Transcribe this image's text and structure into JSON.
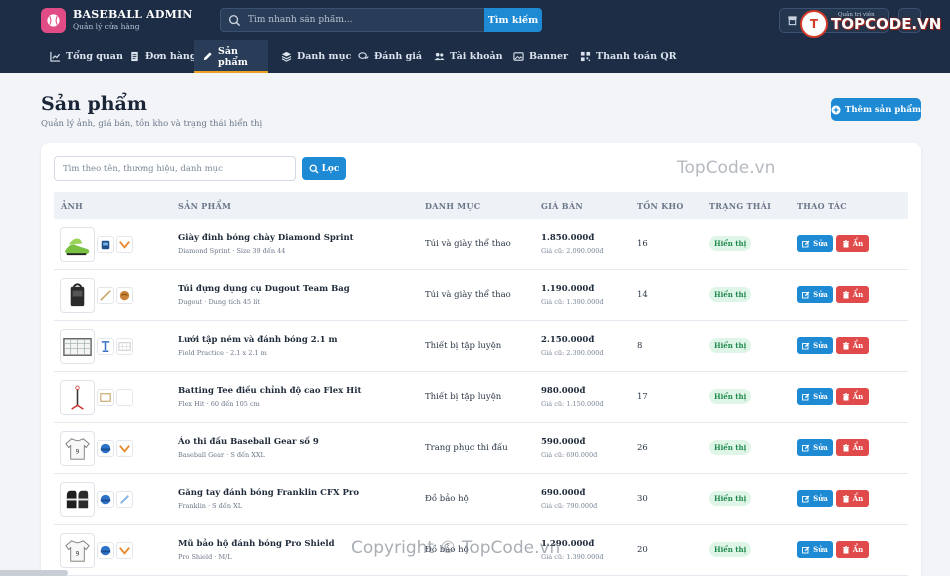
{
  "brand": {
    "name": "BASEBALL ADMIN",
    "subtitle": "Quản lý cửa hàng"
  },
  "search": {
    "placeholder": "Tìm nhanh sản phẩm...",
    "button": "Tìm kiếm"
  },
  "header_right": {
    "shop_small_label": "Quản trị viên"
  },
  "nav": [
    {
      "label": "Tổng quan",
      "icon": "chart-line-icon"
    },
    {
      "label": "Đơn hàng",
      "icon": "receipt-icon"
    },
    {
      "label": "Sản phẩm",
      "icon": "pen-icon",
      "active": true
    },
    {
      "label": "Danh mục",
      "icon": "layers-icon"
    },
    {
      "label": "Đánh giá",
      "icon": "comments-icon"
    },
    {
      "label": "Tài khoản",
      "icon": "users-icon"
    },
    {
      "label": "Banner",
      "icon": "image-icon"
    },
    {
      "label": "Thanh toán QR",
      "icon": "qr-icon"
    }
  ],
  "page": {
    "title": "Sản phẩm",
    "subtitle": "Quản lý ảnh, giá bán, tồn kho và trạng thái hiển thị",
    "add_button": "Thêm sản phẩm"
  },
  "filter": {
    "placeholder": "Tìm theo tên, thương hiệu, danh mục",
    "button": "Lọc"
  },
  "table": {
    "headers": [
      "ẢNH",
      "SẢN PHẨM",
      "DANH MỤC",
      "GIÁ BÁN",
      "TỒN KHO",
      "TRẠNG THÁI",
      "THAO TÁC"
    ],
    "edit_label": "Sửa",
    "hide_label": "Ẩn",
    "rows": [
      {
        "name": "Giày đinh bóng chày Diamond Sprint",
        "meta": "Diamond Sprint · Size 39 đến 44",
        "category": "Túi và giày thể thao",
        "price": "1.850.000đ",
        "old_price": "Giá cũ: 2.090.000đ",
        "stock": "16",
        "status": "Hiển thị",
        "thumb": "shoe"
      },
      {
        "name": "Túi đựng dụng cụ Dugout Team Bag",
        "meta": "Dugout · Dung tích 45 lít",
        "category": "Túi và giày thể thao",
        "price": "1.190.000đ",
        "old_price": "Giá cũ: 1.390.000đ",
        "stock": "14",
        "status": "Hiển thị",
        "thumb": "bag"
      },
      {
        "name": "Lưới tập ném và đánh bóng 2.1 m",
        "meta": "Field Practice · 2.1 x 2.1 m",
        "category": "Thiết bị tập luyện",
        "price": "2.150.000đ",
        "old_price": "Giá cũ: 2.390.000đ",
        "stock": "8",
        "status": "Hiển thị",
        "thumb": "net"
      },
      {
        "name": "Batting Tee điều chỉnh độ cao Flex Hit",
        "meta": "Flex Hit · 60 đến 105 cm",
        "category": "Thiết bị tập luyện",
        "price": "980.000đ",
        "old_price": "Giá cũ: 1.150.000đ",
        "stock": "17",
        "status": "Hiển thị",
        "thumb": "tee"
      },
      {
        "name": "Áo thi đấu Baseball Gear số 9",
        "meta": "Baseball Gear · S đến XXL",
        "category": "Trang phục thi đấu",
        "price": "590.000đ",
        "old_price": "Giá cũ: 690.000đ",
        "stock": "26",
        "status": "Hiển thị",
        "thumb": "shirt"
      },
      {
        "name": "Găng tay đánh bóng Franklin CFX Pro",
        "meta": "Franklin · S đến XL",
        "category": "Đồ bảo hộ",
        "price": "690.000đ",
        "old_price": "Giá cũ: 790.000đ",
        "stock": "30",
        "status": "Hiển thị",
        "thumb": "gloves"
      },
      {
        "name": "Mũ bảo hộ đánh bóng Pro Shield",
        "meta": "Pro Shield · M/L",
        "category": "Đồ bảo hộ",
        "price": "1.290.000đ",
        "old_price": "Giá cũ: 1.390.000đ",
        "stock": "20",
        "status": "Hiển thị",
        "thumb": "shirt"
      }
    ]
  },
  "watermarks": {
    "center": "TopCode.vn",
    "bottom": "Copyright © TopCode.vn",
    "logo_mark": "T",
    "logo_word": "TOPCODE.VN"
  },
  "colors": {
    "header_bg": "#1c2d45",
    "primary": "#1d8ad3",
    "danger": "#e04a4a",
    "success_bg": "#dff5e8",
    "success_text": "#1f8a4d",
    "brand_pink": "#e24c86",
    "active_underline": "#f0a020"
  }
}
